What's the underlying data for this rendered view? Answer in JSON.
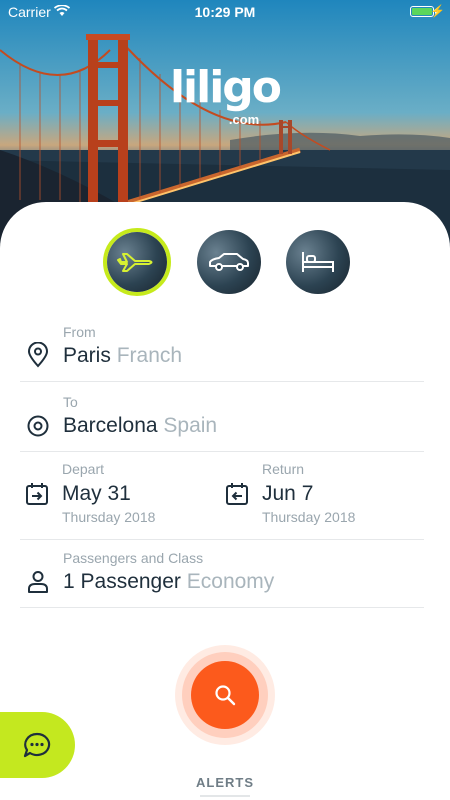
{
  "status_bar": {
    "carrier": "Carrier",
    "time": "10:29 PM"
  },
  "logo": {
    "brand": "liligo",
    "tld": ".com"
  },
  "modes": [
    {
      "name": "flight",
      "icon": "plane-icon",
      "selected": true
    },
    {
      "name": "car",
      "icon": "car-icon",
      "selected": false
    },
    {
      "name": "hotel",
      "icon": "bed-icon",
      "selected": false
    }
  ],
  "from": {
    "label": "From",
    "city": "Paris",
    "country": "Franch",
    "icon": "location-pin-icon"
  },
  "to": {
    "label": "To",
    "city": "Barcelona",
    "country": "Spain",
    "icon": "target-icon"
  },
  "depart": {
    "label": "Depart",
    "date": "May 31",
    "weekday_year": "Thursday 2018",
    "icon": "calendar-depart-icon"
  },
  "return": {
    "label": "Return",
    "date": "Jun 7",
    "weekday_year": "Thursday 2018",
    "icon": "calendar-return-icon"
  },
  "passengers": {
    "label": "Passengers and Class",
    "count": "1 Passenger",
    "class": "Economy",
    "icon": "person-icon"
  },
  "search": {
    "icon": "search-icon",
    "color": "#fc5a1c"
  },
  "chat": {
    "icon": "chat-icon",
    "color": "#c4e81f"
  },
  "alerts_label": "ALERTS",
  "colors": {
    "accent": "#c6ea1c",
    "primary_text": "#1f2f3c",
    "secondary_text": "#9aa6ae"
  }
}
